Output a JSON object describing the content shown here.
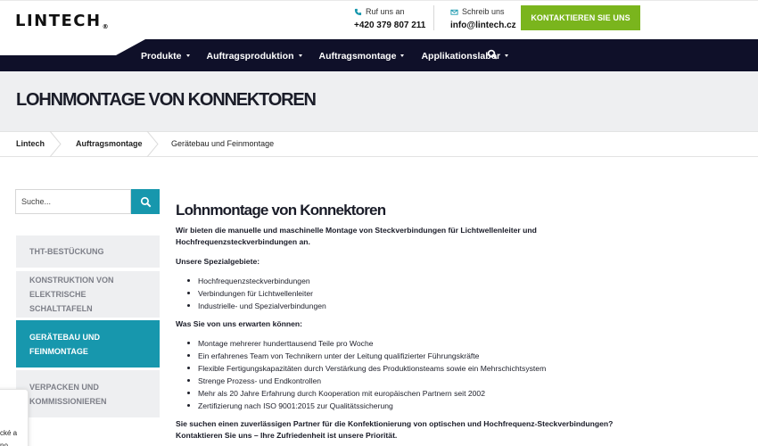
{
  "header": {
    "logo_text": "LINTECH",
    "logo_reg": "®",
    "phone_label": "Ruf uns an",
    "phone_value": "+420 379 807 211",
    "email_label": "Schreib uns",
    "email_value": "info@lintech.cz",
    "cta_label": "KONTAKTIEREN SIE UNS"
  },
  "nav": {
    "items": [
      {
        "label": "Produkte"
      },
      {
        "label": "Auftragsproduktion"
      },
      {
        "label": "Auftragsmontage"
      },
      {
        "label": "Applikationslabor"
      }
    ],
    "search_icon": "search-icon"
  },
  "page": {
    "title": "LOHNMONTAGE VON KONNEKTOREN"
  },
  "breadcrumb": [
    "Lintech",
    "Auftragsmontage",
    "Gerätebau und Feinmontage"
  ],
  "sidebar": {
    "search_placeholder": "Suche...",
    "items": [
      {
        "label": "THT-BESTÜCKUNG",
        "active": false
      },
      {
        "label": "KONSTRUKTION VON ELEKTRISCHE SCHALTTAFELN",
        "active": false
      },
      {
        "label": "GERÄTEBAU UND FEINMONTAGE",
        "active": true
      },
      {
        "label": "VERPACKEN UND KOMMISSIONIEREN",
        "active": false
      }
    ]
  },
  "content": {
    "heading": "Lohnmontage von Konnektoren",
    "intro": "Wir bieten die manuelle und maschinelle Montage von Steckverbindungen für Lichtwellenleiter und Hochfrequenzsteckverbindungen an.",
    "special_title": "Unsere Spezialgebiete:",
    "special_list": [
      "Hochfrequenzsteckverbindungen",
      "Verbindungen für Lichtwellenleiter",
      "Industrielle- und Spezialverbindungen"
    ],
    "expect_title": "Was Sie von uns erwarten können:",
    "expect_list": [
      "Montage mehrerer hunderttausend Teile pro Woche",
      "Ein erfahrenes Team von Technikern unter der Leitung qualifizierter Führungskräfte",
      "Flexible Fertigungskapazitäten durch Verstärkung des Produktionsteams sowie ein Mehrschichtsystem",
      "Strenge Prozess- und Endkontrollen",
      "Mehr als 20 Jahre Erfahrung durch Kooperation mit europäischen Partnern seit 2002",
      "Zertifizierung nach ISO 9001:2015 zur Qualitätssicherung"
    ],
    "closing": "Sie suchen einen zuverlässigen Partner für die Konfektionierung von optischen und Hochfrequenz-Steckverbindungen? Kontaktieren Sie uns – Ihre Zufriedenheit ist unsere Priorität."
  },
  "cookie": {
    "line1": "cké a",
    "line2": "no"
  },
  "colors": {
    "navy": "#0f1029",
    "teal": "#1797ad",
    "green": "#7ab51d",
    "grey_band": "#eeeff1"
  }
}
